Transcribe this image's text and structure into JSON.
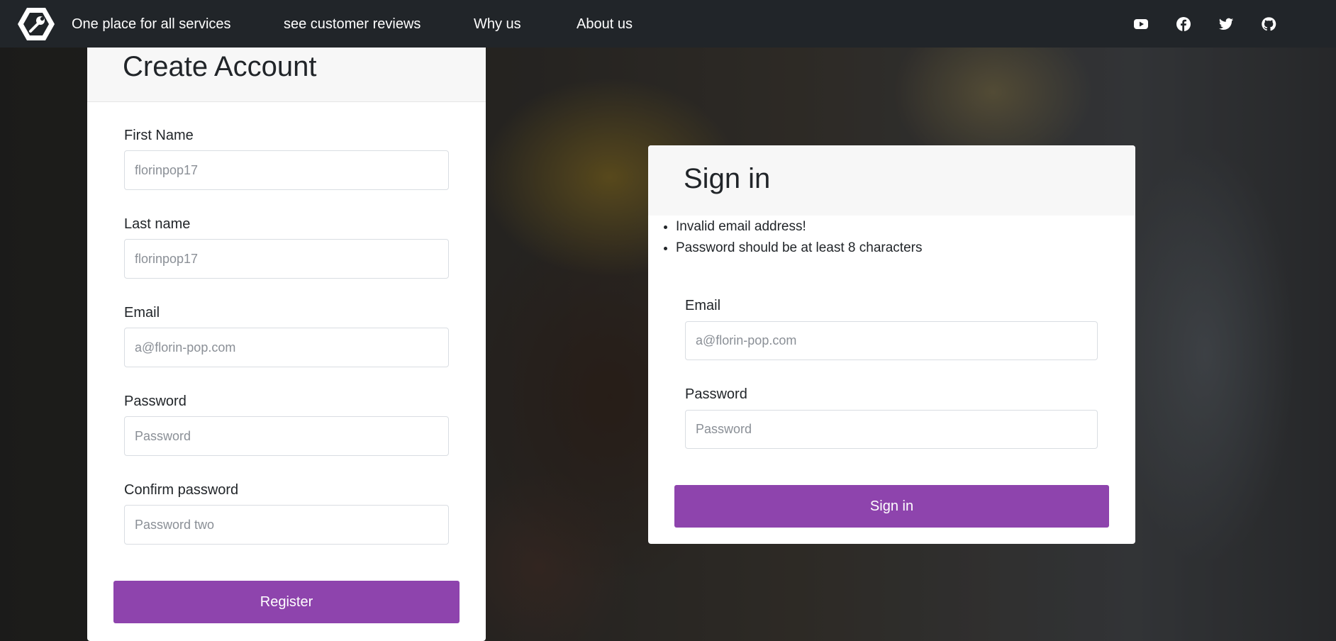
{
  "navbar": {
    "links": [
      {
        "label": "One place for all services"
      },
      {
        "label": "see customer reviews"
      },
      {
        "label": "Why us"
      },
      {
        "label": "About us"
      }
    ],
    "social_icons": [
      "youtube-icon",
      "facebook-icon",
      "twitter-icon",
      "github-icon"
    ]
  },
  "register": {
    "title": "Create Account",
    "fields": [
      {
        "label": "First Name",
        "placeholder": "florinpop17"
      },
      {
        "label": "Last name",
        "placeholder": "florinpop17"
      },
      {
        "label": "Email",
        "placeholder": "a@florin-pop.com"
      },
      {
        "label": "Password",
        "placeholder": "Password"
      },
      {
        "label": "Confirm password",
        "placeholder": "Password two"
      }
    ],
    "button_label": "Register"
  },
  "signin": {
    "title": "Sign in",
    "errors": [
      "Invalid email address!",
      "Password should be at least 8 characters"
    ],
    "fields": [
      {
        "label": "Email",
        "placeholder": "a@florin-pop.com"
      },
      {
        "label": "Password",
        "placeholder": "Password"
      }
    ],
    "button_label": "Sign in"
  },
  "colors": {
    "navbar": "#212529",
    "accent": "#8e44ad",
    "card_header": "#f7f7f7"
  }
}
